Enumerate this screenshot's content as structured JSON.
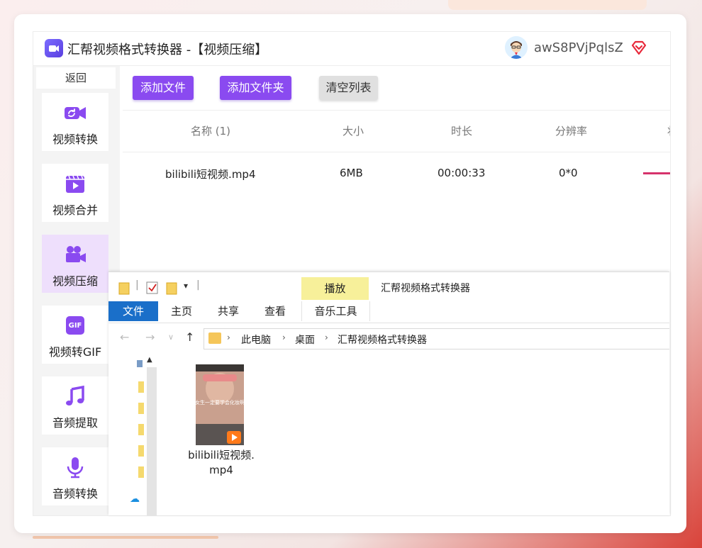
{
  "app": {
    "title": "汇帮视频格式转换器   -【视频压缩】",
    "username": "awS8PVjPqlsZ"
  },
  "sidebar": {
    "back": "返回",
    "items": [
      {
        "label": "视频转换",
        "icon": "video-convert-icon",
        "active": false
      },
      {
        "label": "视频合并",
        "icon": "video-merge-icon",
        "active": false
      },
      {
        "label": "视频压缩",
        "icon": "video-compress-icon",
        "active": true
      },
      {
        "label": "视频转GIF",
        "icon": "gif-icon",
        "active": false
      },
      {
        "label": "音频提取",
        "icon": "music-note-icon",
        "active": false
      },
      {
        "label": "音频转换",
        "icon": "microphone-icon",
        "active": false
      }
    ]
  },
  "toolbar": {
    "add_file": "添加文件",
    "add_folder": "添加文件夹",
    "clear_list": "清空列表"
  },
  "table": {
    "headers": [
      "名称 (1)",
      "大小",
      "时长",
      "分辨率",
      "状"
    ],
    "rows": [
      {
        "name": "bilibili短视频.mp4",
        "size": "6MB",
        "duration": "00:00:33",
        "resolution": "0*0"
      }
    ]
  },
  "explorer": {
    "ribbon_play": "播放",
    "window_title": "汇帮视频格式转换器",
    "tabs": [
      "文件",
      "主页",
      "共享",
      "查看",
      "音乐工具"
    ],
    "breadcrumb": [
      "此电脑",
      "桌面",
      "汇帮视频格式转换器"
    ],
    "file_name_line1": "bilibili短视频.",
    "file_name_line2": "mp4",
    "thumb_caption": "女生一定要学会化妆啊"
  },
  "colors": {
    "accent": "#8a4af0",
    "active_sidebar": "#eedffc",
    "progress": "#d6336c",
    "file_tab": "#1a6fc9"
  }
}
